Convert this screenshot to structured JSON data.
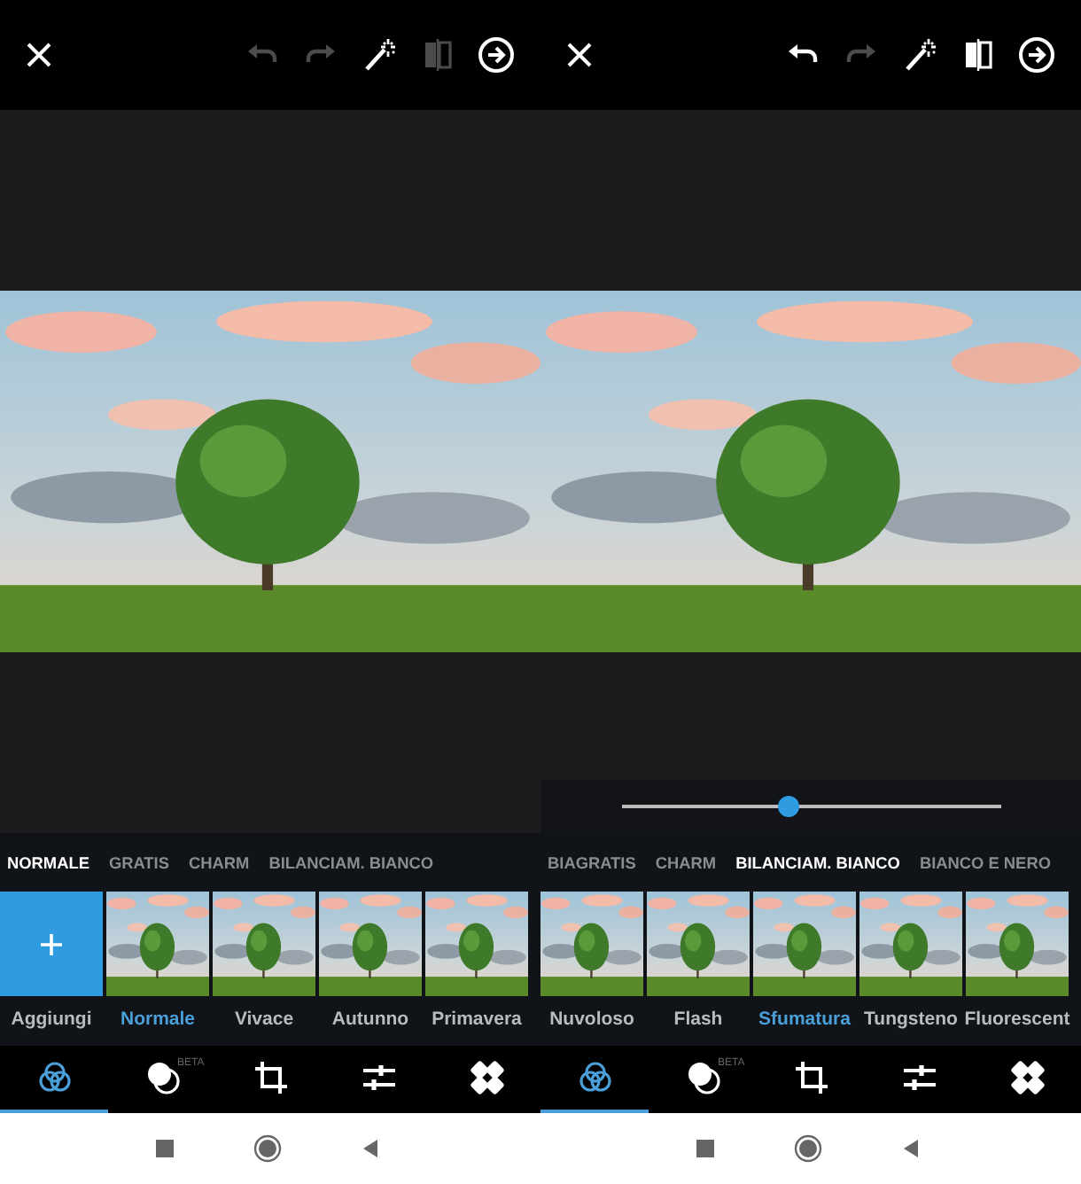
{
  "screens": [
    {
      "toolbar": [
        {
          "kind": "close",
          "disabled": false
        },
        {
          "kind": "undo",
          "disabled": true
        },
        {
          "kind": "redo",
          "disabled": true
        },
        {
          "kind": "wand",
          "disabled": false
        },
        {
          "kind": "compare",
          "disabled": true
        },
        {
          "kind": "next",
          "disabled": false
        }
      ],
      "categories": [
        {
          "label": "NORMALE",
          "selected": true
        },
        {
          "label": "GRATIS",
          "selected": false
        },
        {
          "label": "CHARM",
          "selected": false
        },
        {
          "label": "BILANCIAM. BIANCO",
          "selected": false
        }
      ],
      "filters": [
        {
          "kind": "add",
          "label": "Aggiungi",
          "selected": false
        },
        {
          "kind": "preset",
          "label": "Normale",
          "selected": true
        },
        {
          "kind": "preset",
          "label": "Vivace",
          "selected": false
        },
        {
          "kind": "preset",
          "label": "Autunno",
          "selected": false
        },
        {
          "kind": "preset",
          "label": "Primavera",
          "selected": false
        }
      ],
      "tools": [
        {
          "kind": "filters",
          "selected": true
        },
        {
          "kind": "blend",
          "badge": "BETA",
          "selected": false
        },
        {
          "kind": "crop",
          "selected": false
        },
        {
          "kind": "adjust",
          "selected": false
        },
        {
          "kind": "heal",
          "selected": false
        }
      ]
    },
    {
      "toolbar": [
        {
          "kind": "close",
          "disabled": false
        },
        {
          "kind": "undo",
          "disabled": false
        },
        {
          "kind": "redo",
          "disabled": true
        },
        {
          "kind": "wand",
          "disabled": false
        },
        {
          "kind": "compare",
          "disabled": false
        },
        {
          "kind": "next",
          "disabled": false
        }
      ],
      "slider": {
        "level": 0.44
      },
      "categories": [
        {
          "label": "BIAGRATIS",
          "selected": false
        },
        {
          "label": "CHARM",
          "selected": false
        },
        {
          "label": "BILANCIAM. BIANCO",
          "selected": true
        },
        {
          "label": "BIANCO E NERO",
          "selected": false
        }
      ],
      "filters": [
        {
          "kind": "preset",
          "label": "Nuvoloso",
          "selected": false
        },
        {
          "kind": "preset",
          "label": "Flash",
          "selected": false
        },
        {
          "kind": "preset",
          "label": "Sfumatura",
          "selected": true
        },
        {
          "kind": "preset",
          "label": "Tungsteno",
          "selected": false
        },
        {
          "kind": "preset",
          "label": "Fluorescent",
          "selected": false
        }
      ],
      "tools": [
        {
          "kind": "filters",
          "selected": true
        },
        {
          "kind": "blend",
          "badge": "BETA",
          "selected": false
        },
        {
          "kind": "crop",
          "selected": false
        },
        {
          "kind": "adjust",
          "selected": false
        },
        {
          "kind": "heal",
          "selected": false
        }
      ]
    }
  ]
}
